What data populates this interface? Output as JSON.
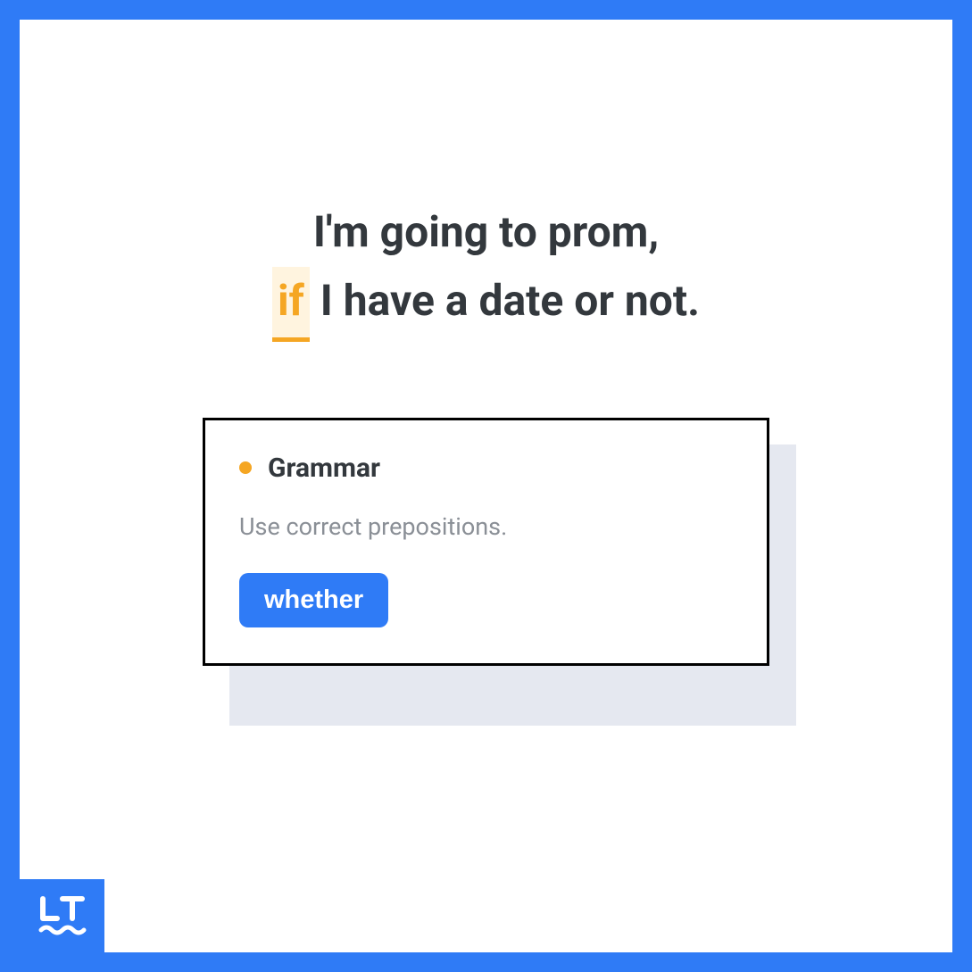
{
  "sentence": {
    "line1": "I'm going to prom,",
    "highlighted_word": "if",
    "line2_rest": " I have a date or not."
  },
  "suggestion": {
    "category": "Grammar",
    "description": "Use correct prepositions.",
    "replacement": "whether"
  },
  "colors": {
    "brand_blue": "#2f7bf6",
    "highlight_bg": "#fff4df",
    "highlight_fg": "#f5a623",
    "text_primary": "#33383d",
    "text_secondary": "#8a8f96",
    "shadow_fill": "#e5e8f0"
  }
}
